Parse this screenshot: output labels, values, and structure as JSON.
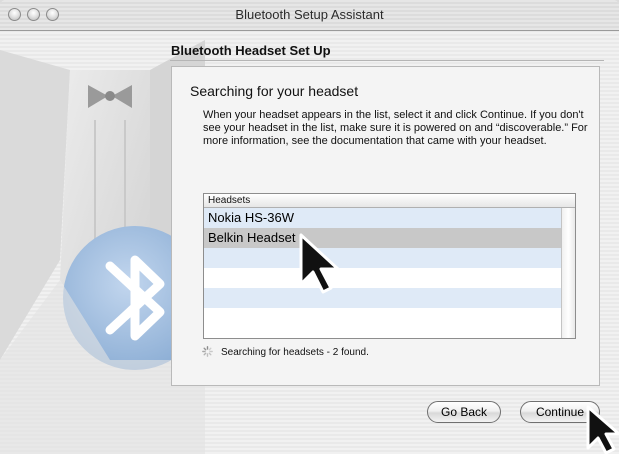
{
  "window": {
    "title": "Bluetooth Setup Assistant"
  },
  "section_title": "Bluetooth Headset Set Up",
  "panel": {
    "heading": "Searching for your headset",
    "instructions": "When your headset appears in the list, select it and click Continue. If you don't see your headset in the list, make sure it is powered on and “discoverable.” For more information, see the documentation that came with your headset."
  },
  "list": {
    "header": "Headsets",
    "items": [
      "Nokia HS-36W",
      "Belkin Headset"
    ],
    "selected": "Belkin Headset"
  },
  "status": "Searching for headsets - 2 found.",
  "buttons": {
    "back": "Go Back",
    "continue": "Continue"
  }
}
